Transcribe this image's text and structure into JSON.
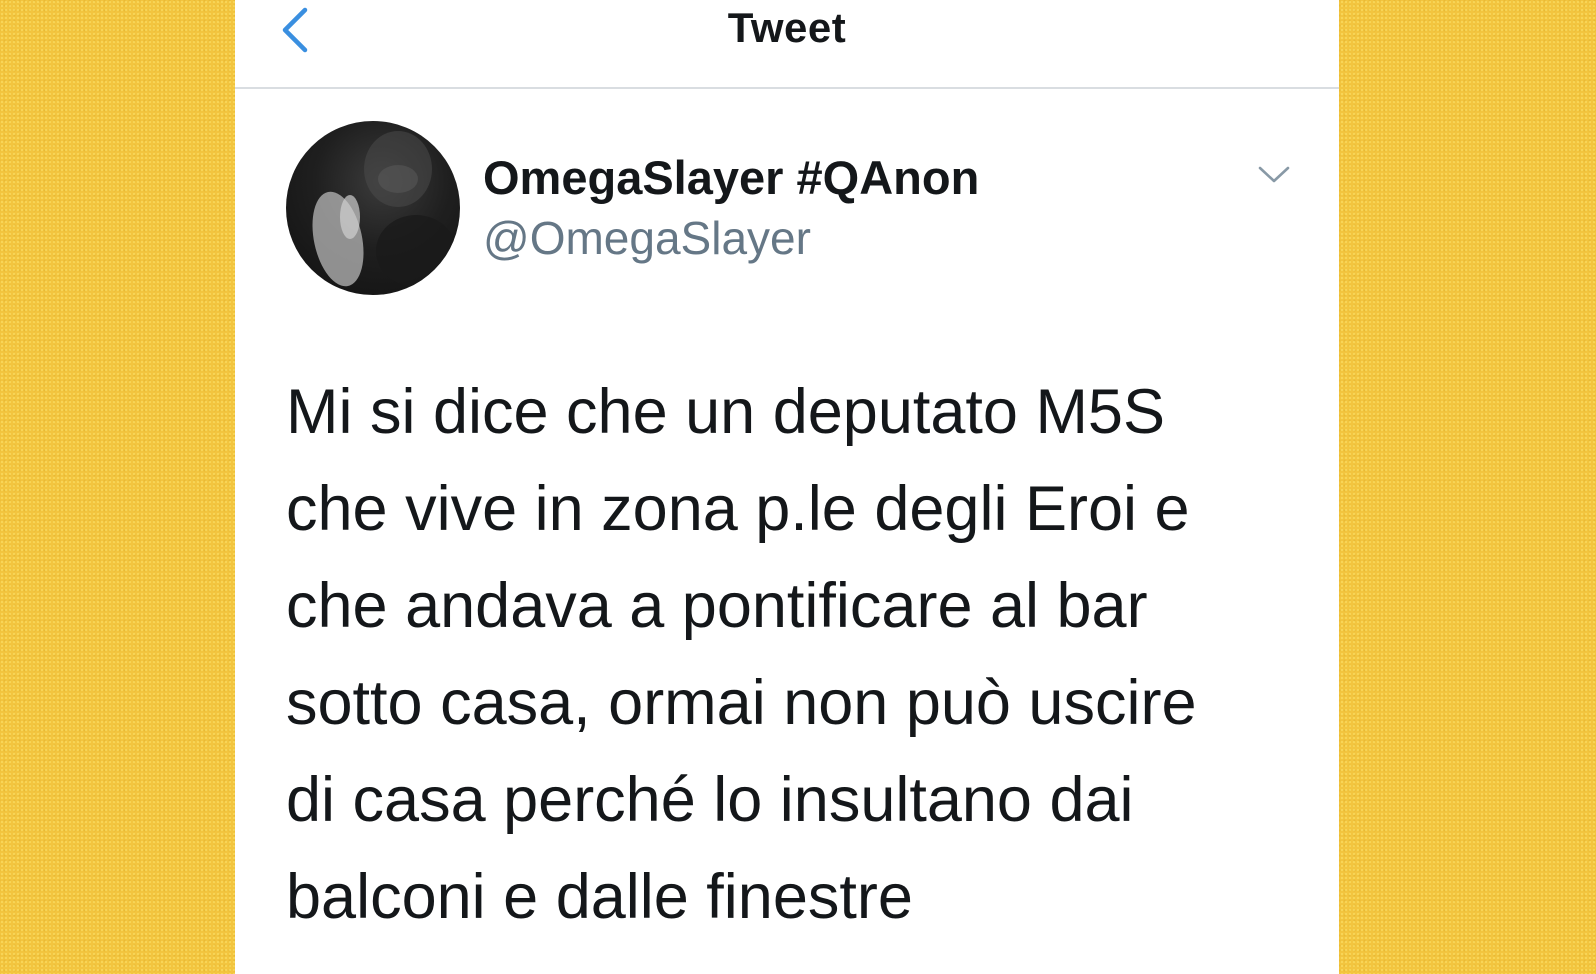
{
  "navbar": {
    "title": "Tweet",
    "back_icon": "chevron-left-icon"
  },
  "tweet": {
    "author": {
      "display_name": "OmegaSlayer #QAnon",
      "handle": "@OmegaSlayer"
    },
    "more_icon": "chevron-down-icon",
    "text": "Mi si dice che un deputato M5S\nche vive in zona p.le degli Eroi e\nche andava a pontificare al bar\nsotto casa, ormai non può uscire\ndi casa perché lo insultano dai\nbalconi e dalle finestre"
  },
  "colors": {
    "background": "#f3c53f",
    "card": "#ffffff",
    "accent": "#1da1f2",
    "text_primary": "#14171a",
    "text_secondary": "#657786",
    "divider": "#d9dde1"
  }
}
